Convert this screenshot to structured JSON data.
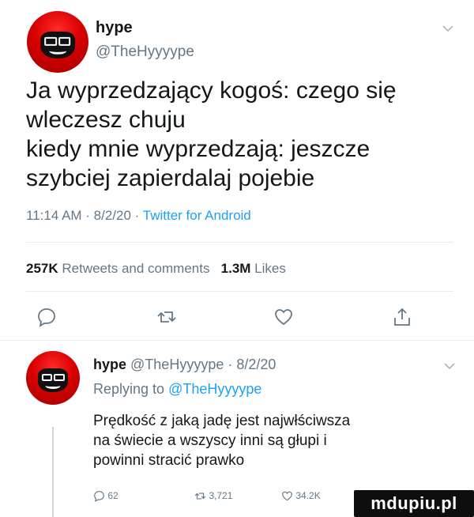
{
  "tweet": {
    "author_name": "hype",
    "author_handle": "@TheHyyyype",
    "text_lines": [
      "Ja wyprzedzający kogoś: czego się",
      "wleczesz chuju",
      "kiedy mnie wyprzedzają: jeszcze",
      "szybciej zapierdalaj pojebie"
    ],
    "time": "11:14 AM · 8/2/20 · ",
    "source": "Twitter for Android",
    "stats": {
      "retweets_count": "257K",
      "retweets_label": "Retweets and comments",
      "likes_count": "1.3M",
      "likes_label": "Likes"
    },
    "actions": [
      "comment-icon",
      "retweet-icon",
      "heart-icon",
      "share-icon"
    ]
  },
  "reply": {
    "author_name": "hype",
    "author_handle": "@TheHyyyype",
    "date": "· 8/2/20",
    "replying_prefix": "Replying to ",
    "replying_to": "@TheHyyyype",
    "text_lines": [
      "Prędkość z jaką jadę jest najwłściwsza",
      "na świecie a wszyscy inni są głupi i",
      "powinni stracić prawko"
    ],
    "comments": "62",
    "retweets": "3,721",
    "likes": "34.2K"
  },
  "watermark": "mdupiu.pl",
  "colors": {
    "text": "#14171a",
    "secondary": "#657786",
    "link": "#1da1f2",
    "avatar_red": "#d80000"
  }
}
